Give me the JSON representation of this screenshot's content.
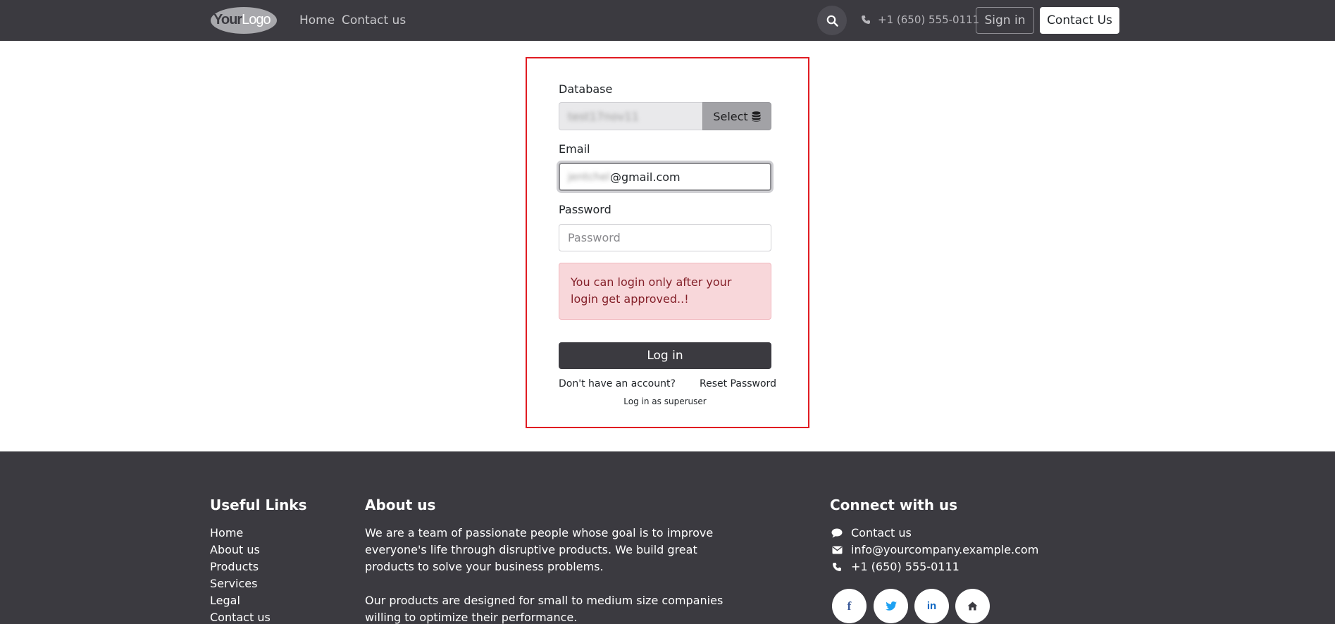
{
  "header": {
    "logo_text_bold": "Your",
    "logo_text_light": "Logo",
    "nav": [
      {
        "label": "Home"
      },
      {
        "label": "Contact us"
      }
    ],
    "phone": "+1 (650) 555-0111",
    "signin_label": "Sign in",
    "contact_label": "Contact Us"
  },
  "login": {
    "database_label": "Database",
    "database_value": "test17nov11",
    "select_label": "Select",
    "email_label": "Email",
    "email_blurred_part": "jentchel",
    "email_visible_part": "@gmail.com",
    "password_label": "Password",
    "password_placeholder": "Password",
    "alert_text": "You can login only after your login get approved..!",
    "login_button": "Log in",
    "signup_link": "Don't have an account?",
    "reset_link": "Reset Password",
    "superuser_link": "Log in as superuser"
  },
  "footer": {
    "useful_links_title": "Useful Links",
    "useful_links": [
      {
        "label": "Home"
      },
      {
        "label": "About us"
      },
      {
        "label": "Products"
      },
      {
        "label": "Services"
      },
      {
        "label": "Legal"
      },
      {
        "label": "Contact us"
      }
    ],
    "about_title": "About us",
    "about_p1": "We are a team of passionate people whose goal is to improve everyone's life through disruptive products. We build great products to solve your business problems.",
    "about_p2": "Our products are designed for small to medium size companies willing to optimize their performance.",
    "connect_title": "Connect with us",
    "connect_items": [
      {
        "label": "Contact us",
        "icon": "comment-icon"
      },
      {
        "label": "info@yourcompany.example.com",
        "icon": "envelope-icon"
      },
      {
        "label": "+1 (650) 555-0111",
        "icon": "phone-icon"
      }
    ],
    "social": [
      {
        "glyph": "f",
        "icon": "facebook-icon",
        "color": "#3b5998"
      },
      {
        "glyph": "t",
        "icon": "twitter-icon",
        "color": "#1da1f2"
      },
      {
        "glyph": "in",
        "icon": "linkedin-icon",
        "color": "#0a66c2"
      },
      {
        "glyph": "⌂",
        "icon": "home-icon",
        "color": "#3b3a40"
      }
    ]
  },
  "colors": {
    "header_bg": "#3b3a40",
    "highlight_border": "#e11b22",
    "alert_bg": "#f8d7da",
    "alert_text": "#842029"
  }
}
